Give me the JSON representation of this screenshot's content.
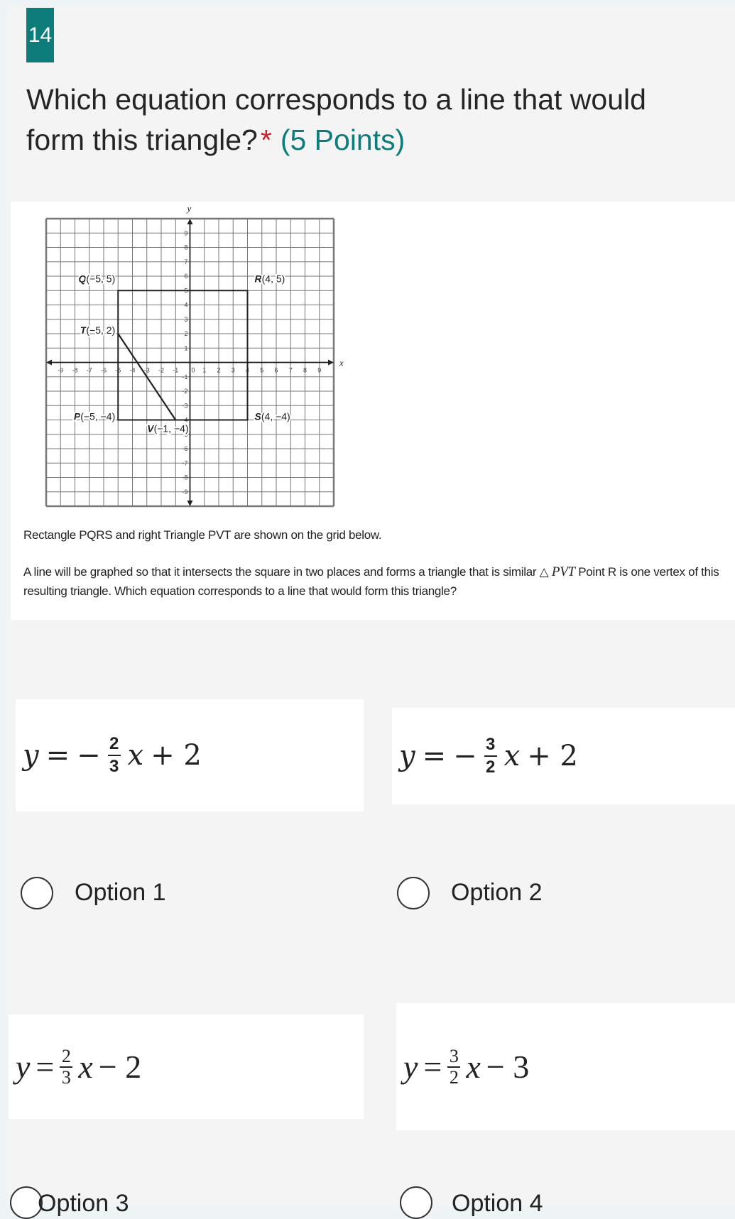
{
  "question": {
    "number": "14",
    "title": "Which equation corresponds to a line that would form this triangle?",
    "required_mark": "*",
    "points": "(5 Points)"
  },
  "graph": {
    "axis_x": "x",
    "axis_y": "y",
    "range": [
      -10,
      10
    ],
    "ticks": [
      -9,
      -8,
      -7,
      -6,
      -5,
      -4,
      -3,
      -2,
      -1,
      1,
      2,
      3,
      4,
      5,
      6,
      7,
      8,
      9
    ],
    "points": [
      {
        "name": "Q",
        "coord": "(−5, 5)",
        "x": -5,
        "y": 5
      },
      {
        "name": "R",
        "coord": "(4, 5)",
        "x": 4,
        "y": 5
      },
      {
        "name": "T",
        "coord": "(−5, 2)",
        "x": -5,
        "y": 2
      },
      {
        "name": "P",
        "coord": "(−5, −4)",
        "x": -5,
        "y": -4
      },
      {
        "name": "S",
        "coord": "(4, −4)",
        "x": 4,
        "y": -4
      },
      {
        "name": "V",
        "coord": "(−1, −4)",
        "x": -1,
        "y": -4
      }
    ]
  },
  "description": {
    "line1": "Rectangle PQRS and right Triangle PVT are shown on the grid below.",
    "line2a": "A line will be graphed so that it intersects the square in two places and forms a triangle that is similar △",
    "line2b_italic": "PVT",
    "line2c": " Point R is one vertex of this resulting triangle. Which equation corresponds to a line that would form this triangle?"
  },
  "options": [
    {
      "label": "Option 1",
      "lhs": "y",
      "eq": "=",
      "sign": "−",
      "num": "2",
      "den": "3",
      "var": "x",
      "rest": "+ 2"
    },
    {
      "label": "Option 2",
      "lhs": "y",
      "eq": "=",
      "sign": "−",
      "num": "3",
      "den": "2",
      "var": "x",
      "rest": "+ 2"
    },
    {
      "label": "Option 3",
      "lhs": "y",
      "eq": "=",
      "sign": "",
      "num": "2",
      "den": "3",
      "var": "x",
      "rest": "− 2"
    },
    {
      "label": "Option 4",
      "lhs": "y",
      "eq": "=",
      "sign": "",
      "num": "3",
      "den": "2",
      "var": "x",
      "rest": "− 3"
    }
  ],
  "colors": {
    "accent": "#0e7c7b",
    "required": "#c4262e",
    "card": "#f4f4f4",
    "background": "#eef4f6"
  }
}
